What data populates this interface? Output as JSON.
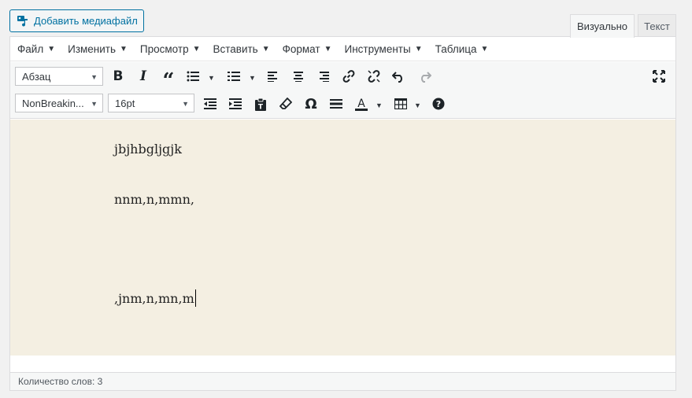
{
  "media_button": {
    "label": "Добавить медиафайл"
  },
  "tabs": {
    "visual": "Визуально",
    "text": "Текст"
  },
  "menu": [
    "Файл",
    "Изменить",
    "Просмотр",
    "Вставить",
    "Формат",
    "Инструменты",
    "Таблица"
  ],
  "toolbar": {
    "block_format": "Абзац",
    "font_family": "NonBreakin...",
    "font_size": "16pt"
  },
  "content": {
    "paragraphs": [
      "jbjhbgljgjk",
      "nnm,n,mmn,",
      ",jnm,n,mn,m"
    ]
  },
  "status": {
    "word_count": "Количество слов: 3"
  },
  "colors": {
    "accent": "#0071a1",
    "content_bg": "#f4efe2"
  }
}
